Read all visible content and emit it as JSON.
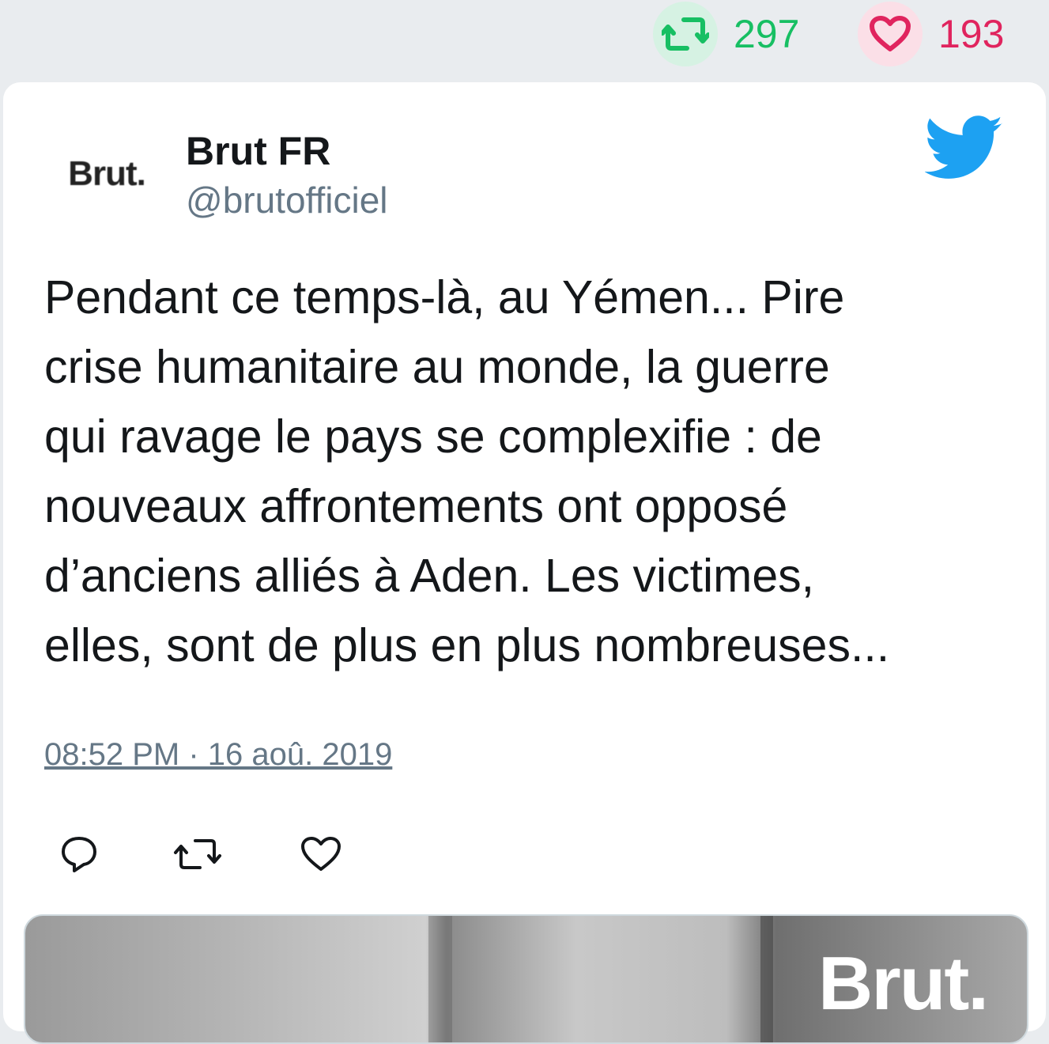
{
  "stats": {
    "retweet_count": "297",
    "like_count": "193"
  },
  "author": {
    "avatar_text": "Brut.",
    "name": "Brut FR",
    "handle": "@brutofficiel"
  },
  "tweet": {
    "text": "Pendant ce temps-là, au Yémen... Pire\ncrise humanitaire au monde, la guerre\nqui ravage le pays se complexifie : de\nnouveaux affrontements ont opposé\nd’anciens alliés à Aden. Les victimes,\nelles, sont de plus en plus nombreuses...",
    "timestamp": "08:52 PM · 16 aoû. 2019"
  },
  "media": {
    "watermark": "Brut."
  },
  "colors": {
    "retweet_green": "#17bf63",
    "like_red": "#e0245e",
    "twitter_blue": "#1da1f2",
    "muted_gray": "#657786"
  },
  "icons": [
    "retweet-icon",
    "heart-icon",
    "twitter-bird-icon",
    "reply-icon"
  ]
}
